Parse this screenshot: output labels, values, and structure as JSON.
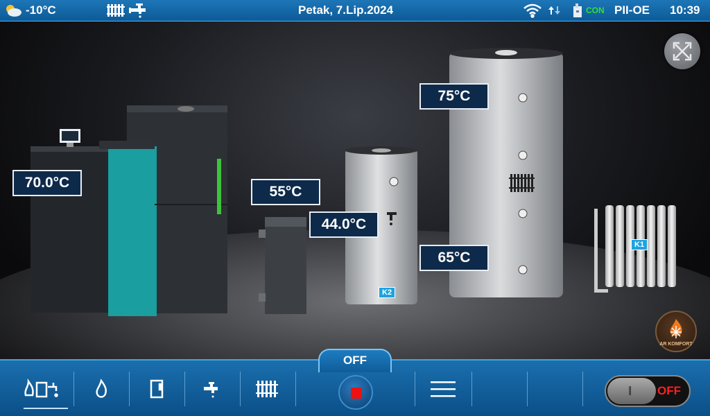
{
  "status_bar": {
    "outdoor_temp": "-10°C",
    "date": "Petak, 7.Lip.2024",
    "con_label": "CON",
    "mode_label": "PII-OE",
    "time": "10:39"
  },
  "scene": {
    "boiler_temp": "70.0°C",
    "hydraulic_temp": "55°C",
    "dhw_tank_temp": "44.0°C",
    "buffer_top_temp": "75°C",
    "buffer_bottom_temp": "65°C",
    "dhw_tank_badge": "K2",
    "radiator_badge": "K1",
    "logo_text": "AR KOMFORT"
  },
  "bottom_bar": {
    "state_label": "OFF",
    "toggle_label": "OFF"
  },
  "colors": {
    "bar_blue": "#0d5a96",
    "label_box_bg": "#0e2a4a",
    "stop_red": "#ee1111",
    "boiler_teal": "#1a9ea0"
  }
}
